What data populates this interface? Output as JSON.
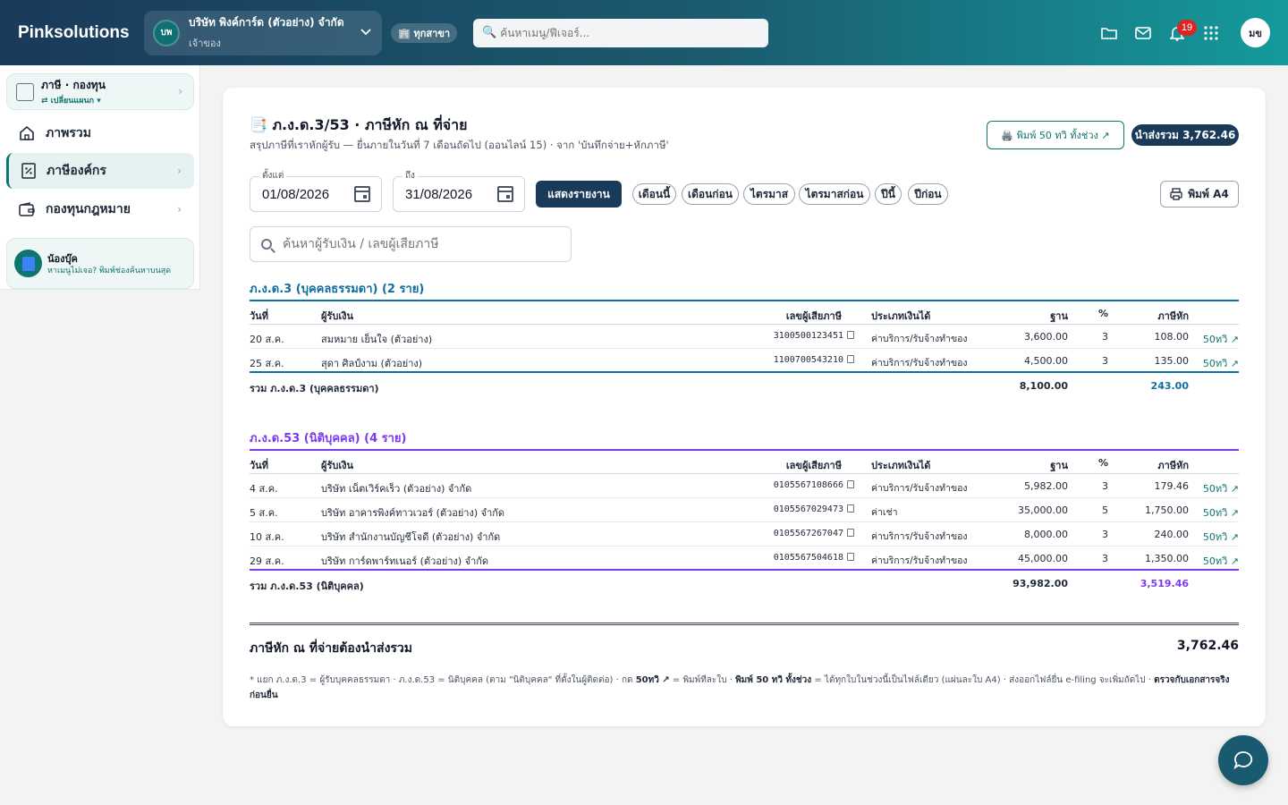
{
  "app": {
    "brand": "Pinksolutions",
    "company_initials": "บพ",
    "company_name": "บริษัท พิงค์การ์ด (ตัวอย่าง) จำกัด",
    "company_role": "เจ้าของ",
    "branch_label": "🏢 ทุกสาขา",
    "search_placeholder": "ค้นหาเมนู/ฟีเจอร์...",
    "notification_count": "19",
    "user_initials": "มข"
  },
  "sidebar": {
    "switcher_title": "ภาษี · กองทุน",
    "switcher_sub": "⇄ เปลี่ยนแผนก ▾",
    "items": [
      {
        "label": "ภาพรวม"
      },
      {
        "label": "ภาษีองค์กร"
      },
      {
        "label": "กองทุนกฎหมาย"
      }
    ],
    "help_title": "น้องบุ๊ค",
    "help_text": "หาเมนูไม่เจอ? พิมพ์ช่องค้นหาบนสุด"
  },
  "page": {
    "title": "📑 ภ.ง.ด.3/53 · ภาษีหัก ณ ที่จ่าย",
    "subtitle": "สรุปภาษีที่เราหักผู้รับ — ยื่นภายในวันที่ 7 เดือนถัดไป (ออนไลน์ 15) · จาก 'บันทึกจ่าย+หักภาษี'",
    "print_all_label": "🖨️ พิมพ์ 50 ทวิ ทั้งช่วง ↗",
    "total_pill": "นำส่งรวม 3,762.46",
    "from_label": "ตั้งแต่",
    "from_value": "01/08/2026",
    "to_label": "ถึง",
    "to_value": "31/08/2026",
    "show_button": "แสดงรายงาน",
    "chips": [
      "เดือนนี้",
      "เดือนก่อน",
      "ไตรมาส",
      "ไตรมาสก่อน",
      "ปีนี้",
      "ปีก่อน"
    ],
    "print_a4": "พิมพ์ A4",
    "search_placeholder": "ค้นหาผู้รับเงิน / เลขผู้เสียภาษี"
  },
  "columns": {
    "date": "วันที่",
    "payee": "ผู้รับเงิน",
    "tin": "เลขผู้เสียภาษี",
    "type": "ประเภทเงินได้",
    "base": "ฐาน",
    "pct": "%",
    "tax": "ภาษีหัก"
  },
  "pnd3": {
    "title": "ภ.ง.ด.3 (บุคคลธรรมดา) (2 ราย)",
    "color": "#0f6fa0",
    "rows": [
      {
        "date": "20 ส.ค.",
        "payee": "สมหมาย เย็นใจ (ตัวอย่าง)",
        "tin": "3100500123451",
        "type": "ค่าบริการ/รับจ้างทำของ",
        "base": "3,600.00",
        "pct": "3",
        "tax": "108.00",
        "link": "50ทวิ ↗"
      },
      {
        "date": "25 ส.ค.",
        "payee": "สุดา ศิลป์งาม (ตัวอย่าง)",
        "tin": "1100700543210",
        "type": "ค่าบริการ/รับจ้างทำของ",
        "base": "4,500.00",
        "pct": "3",
        "tax": "135.00",
        "link": "50ทวิ ↗"
      }
    ],
    "sum_label": "รวม ภ.ง.ด.3 (บุคคลธรรมดา)",
    "sum_base": "8,100.00",
    "sum_tax": "243.00"
  },
  "pnd53": {
    "title": "ภ.ง.ด.53 (นิติบุคคล) (4 ราย)",
    "color": "#7c3aed",
    "rows": [
      {
        "date": "4 ส.ค.",
        "payee": "บริษัท เน็ตเวิร์คเร็ว (ตัวอย่าง) จำกัด",
        "tin": "0105567108666",
        "type": "ค่าบริการ/รับจ้างทำของ",
        "base": "5,982.00",
        "pct": "3",
        "tax": "179.46",
        "link": "50ทวิ ↗"
      },
      {
        "date": "5 ส.ค.",
        "payee": "บริษัท อาคารพิงค์ทาวเวอร์ (ตัวอย่าง) จำกัด",
        "tin": "0105567029473",
        "type": "ค่าเช่า",
        "base": "35,000.00",
        "pct": "5",
        "tax": "1,750.00",
        "link": "50ทวิ ↗"
      },
      {
        "date": "10 ส.ค.",
        "payee": "บริษัท สำนักงานบัญชีโจดี (ตัวอย่าง) จำกัด",
        "tin": "0105567267047",
        "type": "ค่าบริการ/รับจ้างทำของ",
        "base": "8,000.00",
        "pct": "3",
        "tax": "240.00",
        "link": "50ทวิ ↗"
      },
      {
        "date": "29 ส.ค.",
        "payee": "บริษัท การ์ดพาร์ทเนอร์ (ตัวอย่าง) จำกัด",
        "tin": "0105567504618",
        "type": "ค่าบริการ/รับจ้างทำของ",
        "base": "45,000.00",
        "pct": "3",
        "tax": "1,350.00",
        "link": "50ทวิ ↗"
      }
    ],
    "sum_label": "รวม ภ.ง.ด.53 (นิติบุคคล)",
    "sum_base": "93,982.00",
    "sum_tax": "3,519.46"
  },
  "grand": {
    "label": "ภาษีหัก ณ ที่จ่ายต้องนำส่งรวม",
    "value": "3,762.46"
  },
  "footnote": {
    "part1": "* แยก ภ.ง.ด.3 = ผู้รับบุคคลธรรมดา · ภ.ง.ด.53 = นิติบุคคล (ตาม \"นิติบุคคล\" ที่ตั้งในผู้ติดต่อ) · กด ",
    "b1": "50ทวิ ↗",
    "part2": " = พิมพ์ทีละใบ · ",
    "b2": "พิมพ์ 50 ทวิ ทั้งช่วง",
    "part3": " = ได้ทุกใบในช่วงนี้เป็นไฟล์เดียว (แผ่นละใบ A4) · ส่งออกไฟล์ยื่น e-filing จะเพิ่มถัดไป · ",
    "b3": "ตรวจกับเอกสารจริงก่อนยื่น"
  }
}
